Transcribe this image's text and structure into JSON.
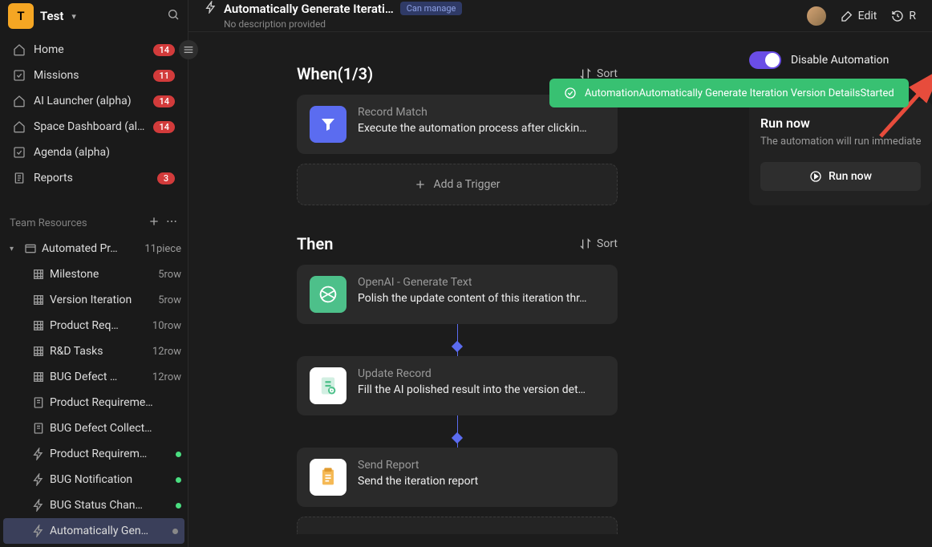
{
  "workspace": {
    "badge": "T",
    "name": "Test"
  },
  "nav": {
    "home": {
      "label": "Home",
      "badge": "14"
    },
    "missions": {
      "label": "Missions",
      "badge": "11"
    },
    "ai_launcher": {
      "label": "AI Launcher (alpha)",
      "badge": "14"
    },
    "space_dashboard": {
      "label": "Space Dashboard (alpha)",
      "badge": "14"
    },
    "agenda": {
      "label": "Agenda (alpha)"
    },
    "reports": {
      "label": "Reports",
      "badge": "3"
    }
  },
  "team_resources": {
    "title": "Team Resources",
    "root": {
      "label": "Automated Pr…",
      "count": "11piece"
    },
    "items": [
      {
        "label": "Milestone",
        "count": "5row",
        "type": "grid"
      },
      {
        "label": "Version Iteration",
        "count": "5row",
        "type": "grid"
      },
      {
        "label": "Product Req…",
        "count": "10row",
        "type": "grid"
      },
      {
        "label": "R&D Tasks",
        "count": "12row",
        "type": "grid"
      },
      {
        "label": "BUG Defect …",
        "count": "12row",
        "type": "grid"
      },
      {
        "label": "Product Requireme…",
        "count": "",
        "type": "form"
      },
      {
        "label": "BUG Defect Collect…",
        "count": "",
        "type": "form"
      },
      {
        "label": "Product Requirem…",
        "count": "",
        "type": "automation",
        "status": "on"
      },
      {
        "label": "BUG Notification",
        "count": "",
        "type": "automation",
        "status": "on"
      },
      {
        "label": "BUG Status Chan…",
        "count": "",
        "type": "automation",
        "status": "on"
      },
      {
        "label": "Automatically Gen…",
        "count": "",
        "type": "automation",
        "status": "off",
        "active": true
      }
    ]
  },
  "header": {
    "title": "Automatically Generate Iterati…",
    "permission": "Can manage",
    "subtitle": "No description provided",
    "edit": "Edit",
    "right": "R"
  },
  "toast": "AutomationAutomatically Generate Iteration Version DetailsStarted",
  "when": {
    "title": "When(1/3)",
    "sort": "Sort",
    "trigger": {
      "title": "Record Match",
      "desc": "Execute the automation process after clickin…"
    },
    "add": "Add a Trigger"
  },
  "then": {
    "title": "Then",
    "sort": "Sort",
    "actions": [
      {
        "icon": "openai",
        "title": "OpenAI - Generate Text",
        "desc": "Polish the update content of this iteration thr…"
      },
      {
        "icon": "update",
        "title": "Update Record",
        "desc": "Fill the AI polished result into the version det…"
      },
      {
        "icon": "report",
        "title": "Send Report",
        "desc": "Send the iteration report"
      }
    ]
  },
  "right_panel": {
    "toggle_label": "Disable Automation",
    "run_title": "Run now",
    "run_desc": "The automation will run immediately and",
    "run_btn": "Run now"
  }
}
